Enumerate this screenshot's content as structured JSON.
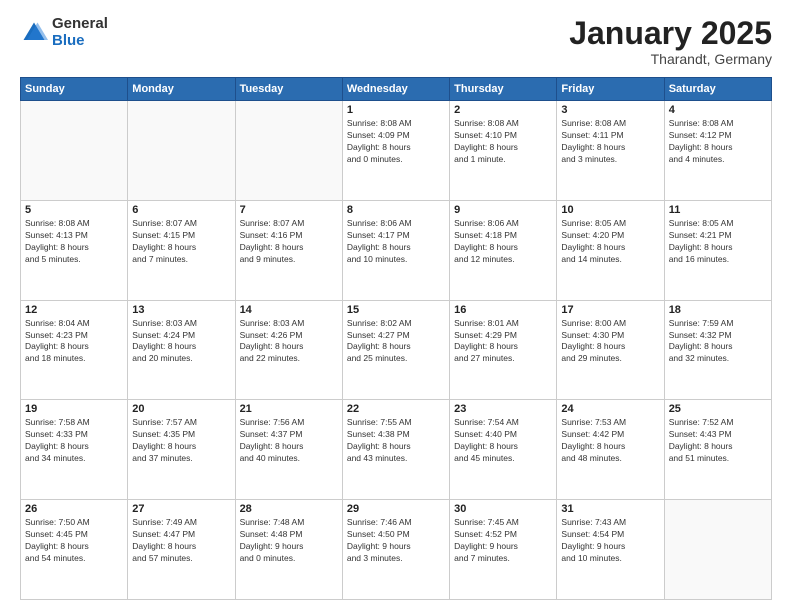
{
  "header": {
    "logo_general": "General",
    "logo_blue": "Blue",
    "month_title": "January 2025",
    "subtitle": "Tharandt, Germany"
  },
  "weekdays": [
    "Sunday",
    "Monday",
    "Tuesday",
    "Wednesday",
    "Thursday",
    "Friday",
    "Saturday"
  ],
  "weeks": [
    [
      {
        "day": "",
        "info": ""
      },
      {
        "day": "",
        "info": ""
      },
      {
        "day": "",
        "info": ""
      },
      {
        "day": "1",
        "info": "Sunrise: 8:08 AM\nSunset: 4:09 PM\nDaylight: 8 hours\nand 0 minutes."
      },
      {
        "day": "2",
        "info": "Sunrise: 8:08 AM\nSunset: 4:10 PM\nDaylight: 8 hours\nand 1 minute."
      },
      {
        "day": "3",
        "info": "Sunrise: 8:08 AM\nSunset: 4:11 PM\nDaylight: 8 hours\nand 3 minutes."
      },
      {
        "day": "4",
        "info": "Sunrise: 8:08 AM\nSunset: 4:12 PM\nDaylight: 8 hours\nand 4 minutes."
      }
    ],
    [
      {
        "day": "5",
        "info": "Sunrise: 8:08 AM\nSunset: 4:13 PM\nDaylight: 8 hours\nand 5 minutes."
      },
      {
        "day": "6",
        "info": "Sunrise: 8:07 AM\nSunset: 4:15 PM\nDaylight: 8 hours\nand 7 minutes."
      },
      {
        "day": "7",
        "info": "Sunrise: 8:07 AM\nSunset: 4:16 PM\nDaylight: 8 hours\nand 9 minutes."
      },
      {
        "day": "8",
        "info": "Sunrise: 8:06 AM\nSunset: 4:17 PM\nDaylight: 8 hours\nand 10 minutes."
      },
      {
        "day": "9",
        "info": "Sunrise: 8:06 AM\nSunset: 4:18 PM\nDaylight: 8 hours\nand 12 minutes."
      },
      {
        "day": "10",
        "info": "Sunrise: 8:05 AM\nSunset: 4:20 PM\nDaylight: 8 hours\nand 14 minutes."
      },
      {
        "day": "11",
        "info": "Sunrise: 8:05 AM\nSunset: 4:21 PM\nDaylight: 8 hours\nand 16 minutes."
      }
    ],
    [
      {
        "day": "12",
        "info": "Sunrise: 8:04 AM\nSunset: 4:23 PM\nDaylight: 8 hours\nand 18 minutes."
      },
      {
        "day": "13",
        "info": "Sunrise: 8:03 AM\nSunset: 4:24 PM\nDaylight: 8 hours\nand 20 minutes."
      },
      {
        "day": "14",
        "info": "Sunrise: 8:03 AM\nSunset: 4:26 PM\nDaylight: 8 hours\nand 22 minutes."
      },
      {
        "day": "15",
        "info": "Sunrise: 8:02 AM\nSunset: 4:27 PM\nDaylight: 8 hours\nand 25 minutes."
      },
      {
        "day": "16",
        "info": "Sunrise: 8:01 AM\nSunset: 4:29 PM\nDaylight: 8 hours\nand 27 minutes."
      },
      {
        "day": "17",
        "info": "Sunrise: 8:00 AM\nSunset: 4:30 PM\nDaylight: 8 hours\nand 29 minutes."
      },
      {
        "day": "18",
        "info": "Sunrise: 7:59 AM\nSunset: 4:32 PM\nDaylight: 8 hours\nand 32 minutes."
      }
    ],
    [
      {
        "day": "19",
        "info": "Sunrise: 7:58 AM\nSunset: 4:33 PM\nDaylight: 8 hours\nand 34 minutes."
      },
      {
        "day": "20",
        "info": "Sunrise: 7:57 AM\nSunset: 4:35 PM\nDaylight: 8 hours\nand 37 minutes."
      },
      {
        "day": "21",
        "info": "Sunrise: 7:56 AM\nSunset: 4:37 PM\nDaylight: 8 hours\nand 40 minutes."
      },
      {
        "day": "22",
        "info": "Sunrise: 7:55 AM\nSunset: 4:38 PM\nDaylight: 8 hours\nand 43 minutes."
      },
      {
        "day": "23",
        "info": "Sunrise: 7:54 AM\nSunset: 4:40 PM\nDaylight: 8 hours\nand 45 minutes."
      },
      {
        "day": "24",
        "info": "Sunrise: 7:53 AM\nSunset: 4:42 PM\nDaylight: 8 hours\nand 48 minutes."
      },
      {
        "day": "25",
        "info": "Sunrise: 7:52 AM\nSunset: 4:43 PM\nDaylight: 8 hours\nand 51 minutes."
      }
    ],
    [
      {
        "day": "26",
        "info": "Sunrise: 7:50 AM\nSunset: 4:45 PM\nDaylight: 8 hours\nand 54 minutes."
      },
      {
        "day": "27",
        "info": "Sunrise: 7:49 AM\nSunset: 4:47 PM\nDaylight: 8 hours\nand 57 minutes."
      },
      {
        "day": "28",
        "info": "Sunrise: 7:48 AM\nSunset: 4:48 PM\nDaylight: 9 hours\nand 0 minutes."
      },
      {
        "day": "29",
        "info": "Sunrise: 7:46 AM\nSunset: 4:50 PM\nDaylight: 9 hours\nand 3 minutes."
      },
      {
        "day": "30",
        "info": "Sunrise: 7:45 AM\nSunset: 4:52 PM\nDaylight: 9 hours\nand 7 minutes."
      },
      {
        "day": "31",
        "info": "Sunrise: 7:43 AM\nSunset: 4:54 PM\nDaylight: 9 hours\nand 10 minutes."
      },
      {
        "day": "",
        "info": ""
      }
    ]
  ]
}
